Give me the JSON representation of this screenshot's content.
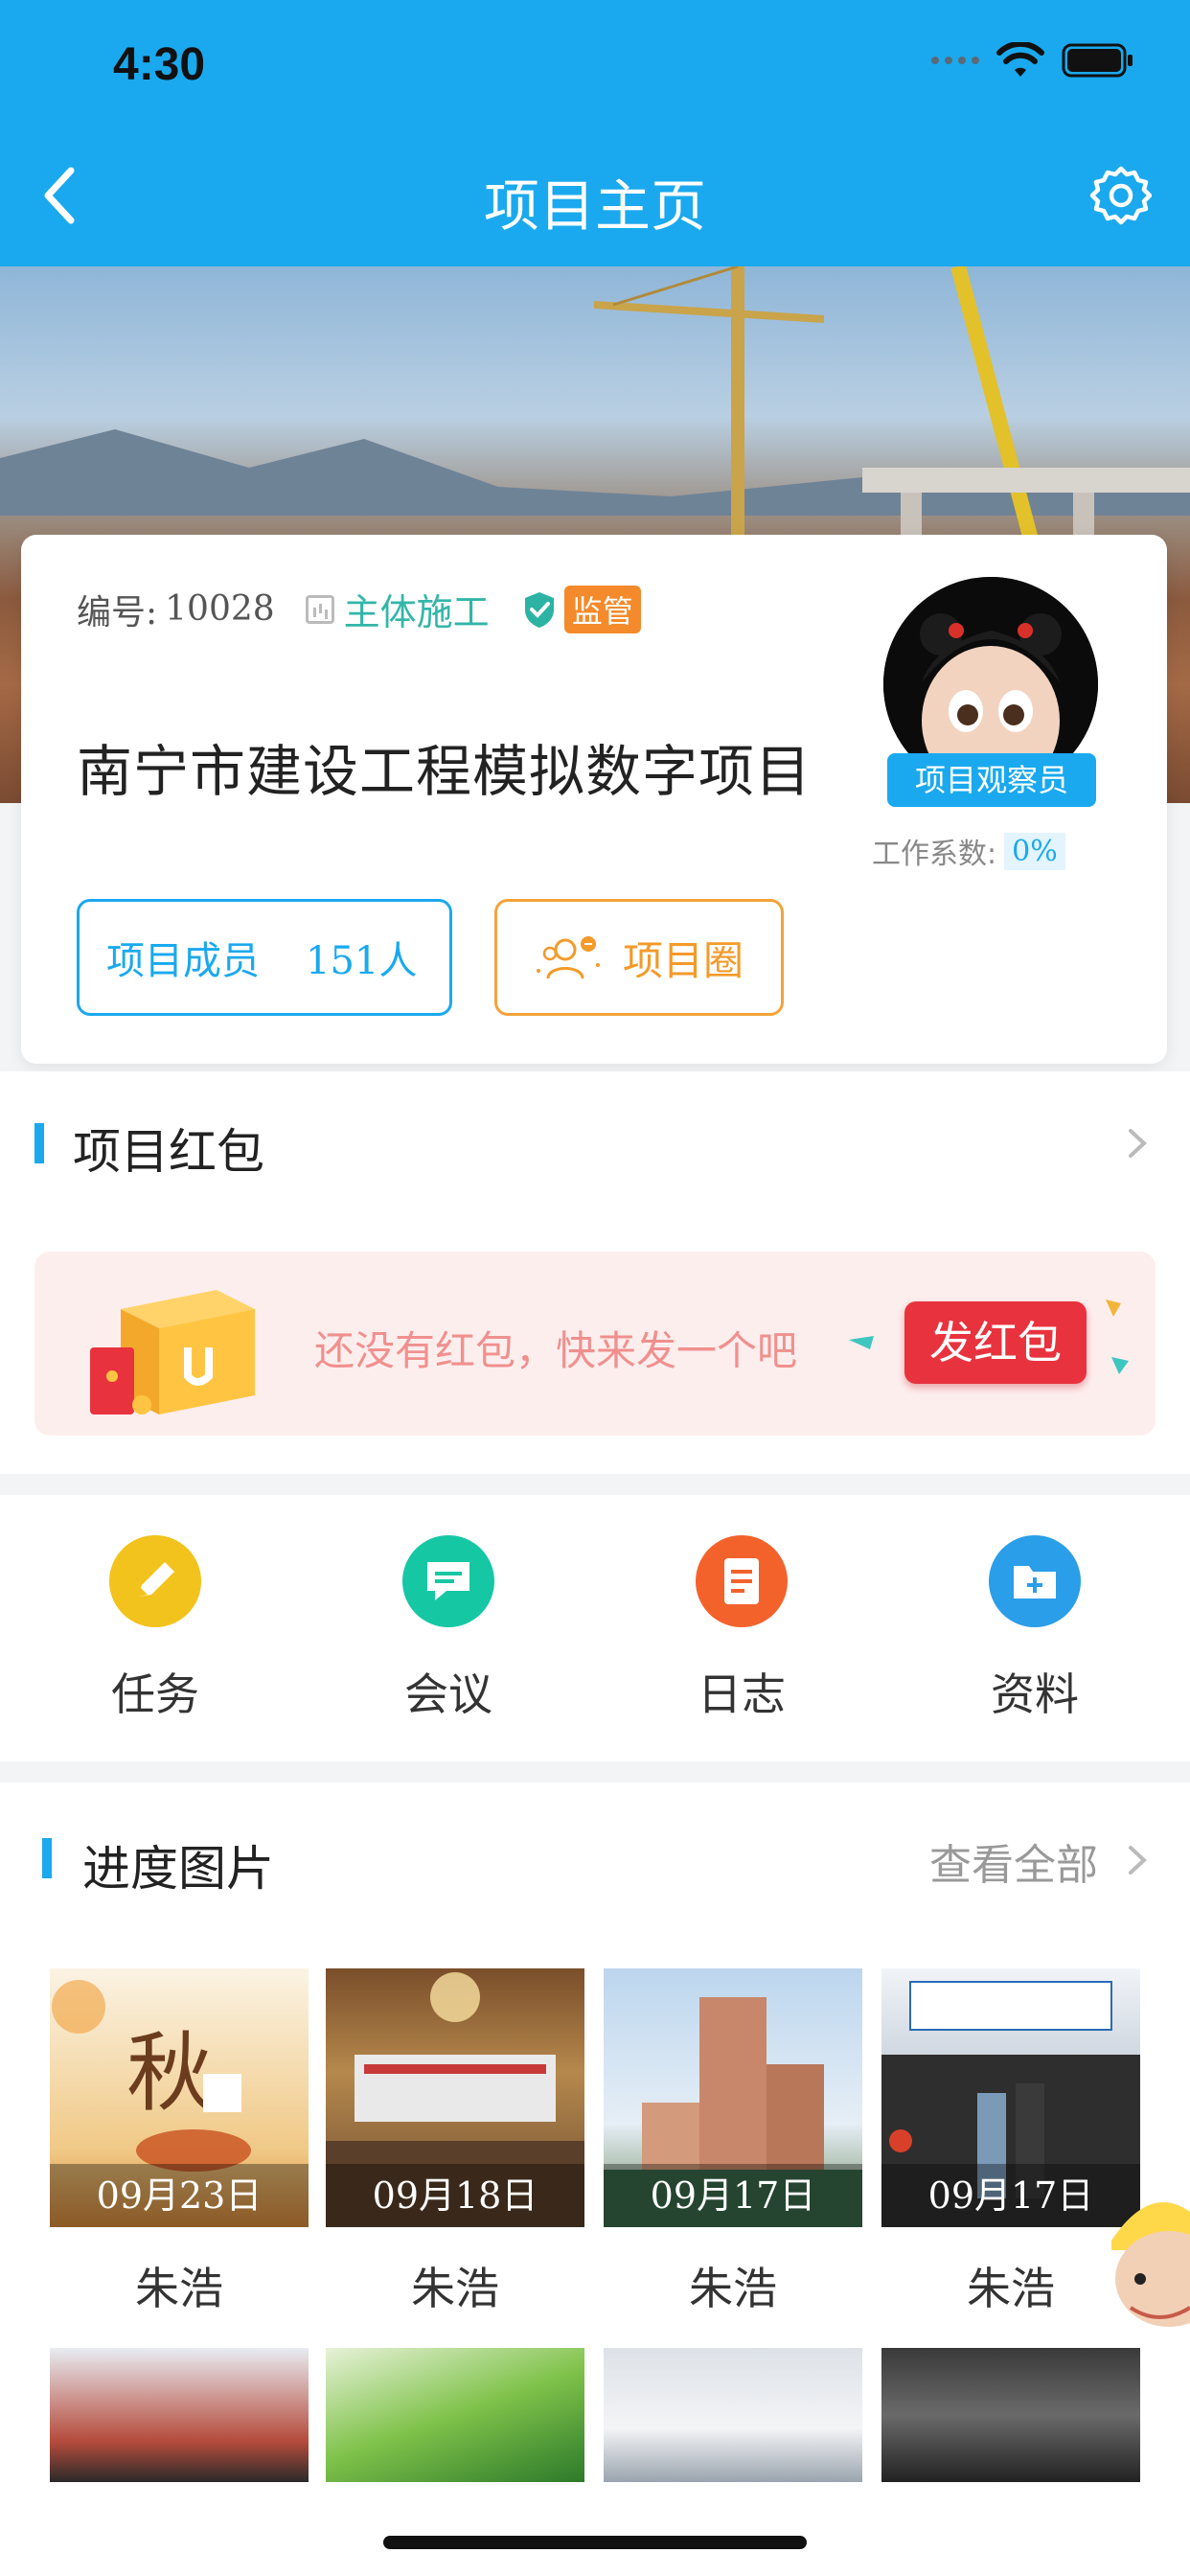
{
  "status_bar": {
    "time": "4:30"
  },
  "nav": {
    "title": "项目主页"
  },
  "project": {
    "number_label": "编号:",
    "number": "10028",
    "stage": "主体施工",
    "supervise_tag": "监管",
    "name": "南宁市建设工程模拟数字项目",
    "role": "项目观察员",
    "coef_label": "工作系数:",
    "coef_value": "0%",
    "members_label": "项目成员",
    "members_count": "151人",
    "circle_label": "项目圈"
  },
  "redpacket": {
    "title": "项目红包",
    "empty_text": "还没有红包，快来发一个吧",
    "send_label": "发红包"
  },
  "quick_actions": [
    {
      "label": "任务",
      "icon": "pencil-icon",
      "color": "#f2c31c"
    },
    {
      "label": "会议",
      "icon": "chat-icon",
      "color": "#16c7a4"
    },
    {
      "label": "日志",
      "icon": "document-icon",
      "color": "#f4622c"
    },
    {
      "label": "资料",
      "icon": "folder-icon",
      "color": "#2a9ee8"
    }
  ],
  "progress": {
    "title": "进度图片",
    "view_all": "查看全部",
    "photos": [
      {
        "date": "09月23日",
        "author": "朱浩"
      },
      {
        "date": "09月18日",
        "author": "朱浩"
      },
      {
        "date": "09月17日",
        "author": "朱浩"
      },
      {
        "date": "09月17日",
        "author": "朱浩"
      }
    ]
  }
}
